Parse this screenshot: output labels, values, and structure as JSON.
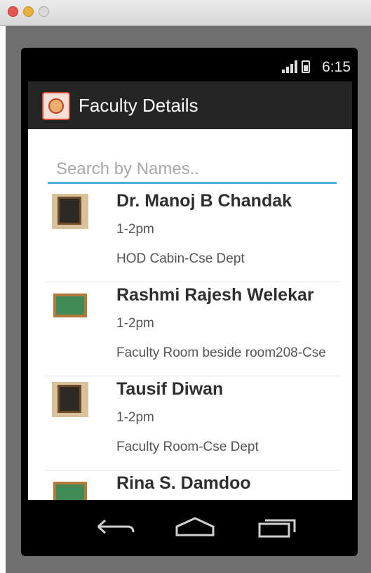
{
  "window": {
    "controls": [
      "close",
      "minimize",
      "zoom"
    ]
  },
  "status_bar": {
    "time": "6:15",
    "icons": [
      "signal-icon",
      "battery-icon"
    ]
  },
  "action_bar": {
    "title": "Faculty Details",
    "icon": "app-logo-icon"
  },
  "search": {
    "placeholder": "Search by Names..",
    "value": "",
    "accent_color": "#4fb3dd"
  },
  "faculty": [
    {
      "name": "Dr. Manoj B Chandak",
      "time": "1-2pm",
      "place": "HOD Cabin-Cse Dept",
      "icon": "blackboard-icon"
    },
    {
      "name": "Rashmi Rajesh Welekar",
      "time": "1-2pm",
      "place": "Faculty Room beside room208-Cse",
      "icon": "greenboard-icon"
    },
    {
      "name": "Tausif Diwan",
      "time": "1-2pm",
      "place": "Faculty Room-Cse Dept",
      "icon": "blackboard-icon"
    },
    {
      "name": "Rina S. Damdoo",
      "time": "",
      "place": "",
      "icon": "greenboard-icon"
    }
  ],
  "nav_bar": {
    "buttons": [
      "back-icon",
      "home-icon",
      "recents-icon"
    ]
  }
}
